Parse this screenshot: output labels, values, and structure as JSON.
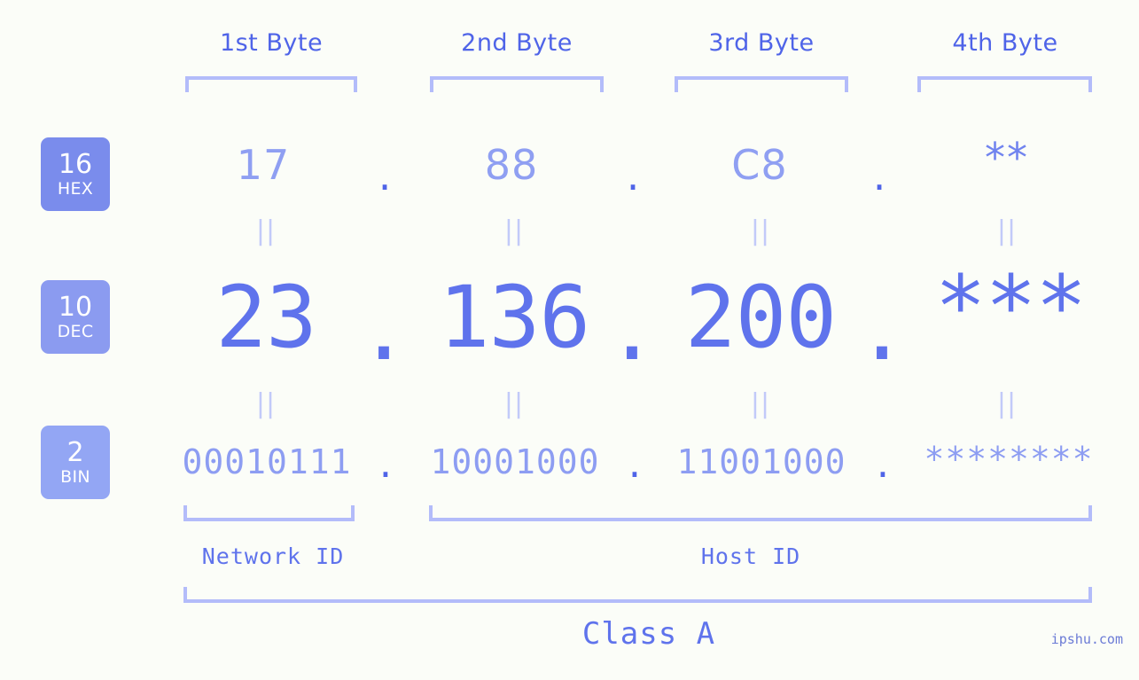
{
  "meta": {
    "background_color": "#fbfdf8",
    "accent_strong": "#4f64e8",
    "accent_mid": "#8f9ff2",
    "accent_light": "#b3bcfa",
    "watermark": "ipshu.com"
  },
  "byte_headers": [
    {
      "label": "1st Byte"
    },
    {
      "label": "2nd Byte"
    },
    {
      "label": "3rd Byte"
    },
    {
      "label": "4th Byte"
    }
  ],
  "radix_badges": [
    {
      "number": "16",
      "name": "HEX",
      "color": "#7a8cec"
    },
    {
      "number": "10",
      "name": "DEC",
      "color": "#8b9bf0"
    },
    {
      "number": "2",
      "name": "BIN",
      "color": "#93a6f4"
    }
  ],
  "rows": {
    "hex": {
      "values": [
        "17",
        "88",
        "C8",
        "**"
      ],
      "separator": "."
    },
    "dec": {
      "values": [
        "23",
        "136",
        "200",
        "***"
      ],
      "separator": "."
    },
    "bin": {
      "values": [
        "00010111",
        "10001000",
        "11001000",
        "********"
      ],
      "separator": "."
    }
  },
  "equals_marks": {
    "glyph": "||",
    "count_per_row": 4
  },
  "id_sections": [
    {
      "label": "Network ID"
    },
    {
      "label": "Host ID"
    }
  ],
  "class_label": "Class A"
}
